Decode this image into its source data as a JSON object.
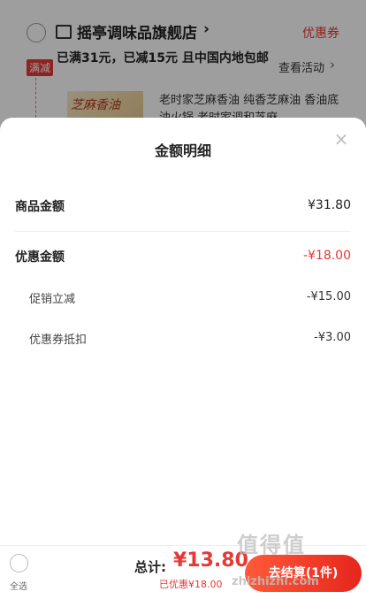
{
  "background": {
    "store_name": "摇亭调味品旗舰店",
    "coupon_link": "优惠券",
    "promo_badge": "满减",
    "promo_text": "已满31元，已减15元 且中国内地包邮",
    "see_activity": "查看活动",
    "thumb_text": "芝麻香油",
    "product_title": "老时家芝麻香油 纯香芝麻油 香油底油火锅 老时家调和芝麻"
  },
  "sheet": {
    "title": "金额明细",
    "close": "×",
    "goods_label": "商品金额",
    "goods_value": "¥31.80",
    "discount_label": "优惠金额",
    "discount_value": "-¥18.00",
    "promo_label": "促销立减",
    "promo_value": "-¥15.00",
    "coupon_label": "优惠券抵扣",
    "coupon_value": "-¥3.00"
  },
  "bottom_bar": {
    "select_all": "全选",
    "total_label": "总计:",
    "total_amount": "¥13.80",
    "saved_text": "已优惠¥18.00",
    "checkout_label": "去结算(1件)"
  },
  "watermark": {
    "text": "值得值",
    "url": "zhizhizhi.com"
  },
  "colors": {
    "accent": "#e53935",
    "checkout": "#e5261c"
  }
}
